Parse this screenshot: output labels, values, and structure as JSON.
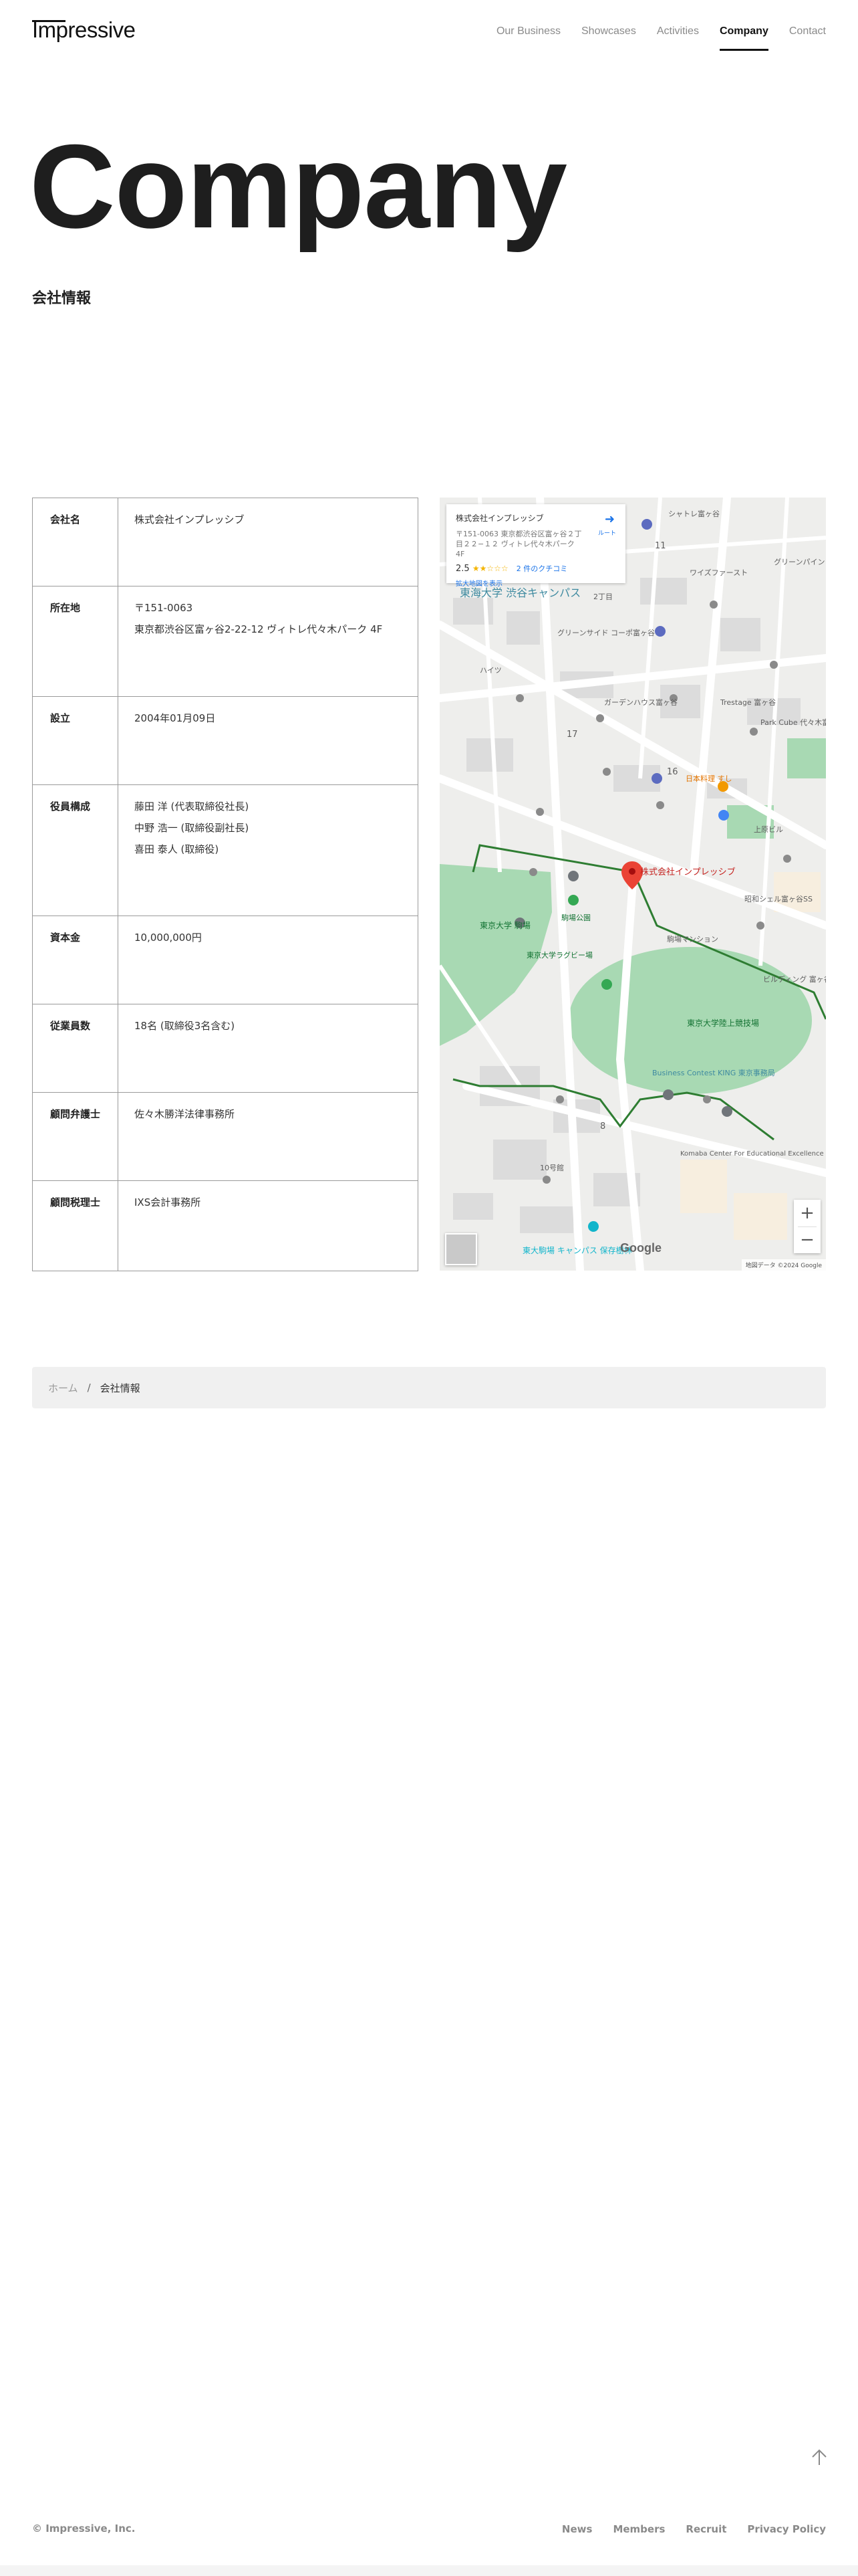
{
  "header": {
    "logo": "Impressive",
    "nav": [
      {
        "label": "Our Business"
      },
      {
        "label": "Showcases"
      },
      {
        "label": "Activities"
      },
      {
        "label": "Company",
        "active": true
      },
      {
        "label": "Contact"
      }
    ]
  },
  "hero": {
    "title": "Company",
    "subtitle": "会社情報"
  },
  "company_table": [
    {
      "key": "会社名",
      "lines": [
        "株式会社インプレッシブ"
      ]
    },
    {
      "key": "所在地",
      "lines": [
        "〒151-0063",
        "東京都渋谷区富ヶ谷2-22-12 ヴィトレ代々木パーク 4F"
      ]
    },
    {
      "key": "設立",
      "lines": [
        "2004年01月09日"
      ]
    },
    {
      "key": "役員構成",
      "lines": [
        "藤田 洋 (代表取締役社長)",
        "中野 浩一 (取締役副社長)",
        "喜田 泰人 (取締役)"
      ]
    },
    {
      "key": "資本金",
      "lines": [
        "10,000,000円"
      ]
    },
    {
      "key": "従業員数",
      "lines": [
        "18名 (取締役3名含む)"
      ]
    },
    {
      "key": "顧問弁護士",
      "lines": [
        "佐々木勝洋法律事務所"
      ]
    },
    {
      "key": "顧問税理士",
      "lines": [
        "IXS会計事務所"
      ]
    }
  ],
  "map": {
    "card_title": "株式会社インプレッシブ",
    "card_address": "〒151-0063 東京都渋谷区富ヶ谷２丁目２２−１２ ヴィトレ代々木パーク 4F",
    "rating": "2.5",
    "reviews": "2 件のクチコミ",
    "larger_map": "拡大地図を表示",
    "directions": "ルート",
    "pin_label": "株式会社インプレッシブ",
    "labels": [
      {
        "text": "東海大学 渋谷キャンパス"
      },
      {
        "text": "東京大学 駒場"
      },
      {
        "text": "東京大学陸上競技場"
      },
      {
        "text": "東京大学ラグビー場"
      },
      {
        "text": "駒場公園"
      },
      {
        "text": "Business Contest KING 東京事務局"
      },
      {
        "text": "Komaba Center For Educational Excellence"
      },
      {
        "text": "東大駒場 キャンパス 保存樹林"
      },
      {
        "text": "シャトレ富ヶ谷"
      },
      {
        "text": "ワイズファースト"
      },
      {
        "text": "グリーンパイン"
      },
      {
        "text": "ガーデンハウス富ヶ谷"
      },
      {
        "text": "Trestage 富ヶ谷"
      },
      {
        "text": "Park Cube 代々木富ヶ谷"
      },
      {
        "text": "日本料理 すし"
      },
      {
        "text": "上原ビル"
      },
      {
        "text": "昭和シェル富ヶ谷SS"
      },
      {
        "text": "ビルディング 富ヶ谷"
      },
      {
        "text": "駒場マンション"
      },
      {
        "text": "グリーンサイド コーポ富ヶ谷"
      },
      {
        "text": "ハイツ"
      },
      {
        "text": "2丁目"
      },
      {
        "text": "11"
      },
      {
        "text": "16"
      },
      {
        "text": "17"
      },
      {
        "text": "8"
      },
      {
        "text": "10号館"
      },
      {
        "text": "Google"
      }
    ],
    "copyright": "地図データ ©2024 Google"
  },
  "breadcrumb": {
    "home": "ホーム",
    "separator": "/",
    "current": "会社情報"
  },
  "footer": {
    "copyright": "© Impressive, Inc.",
    "links": [
      {
        "label": "News"
      },
      {
        "label": "Members"
      },
      {
        "label": "Recruit"
      },
      {
        "label": "Privacy Policy"
      }
    ]
  },
  "colors": {
    "text": "#222222",
    "muted": "#8a8a8a",
    "border": "#9a9a9a",
    "map_green": "#a8d9b3",
    "map_road": "#ffffff",
    "map_pin": "#ea4335"
  }
}
